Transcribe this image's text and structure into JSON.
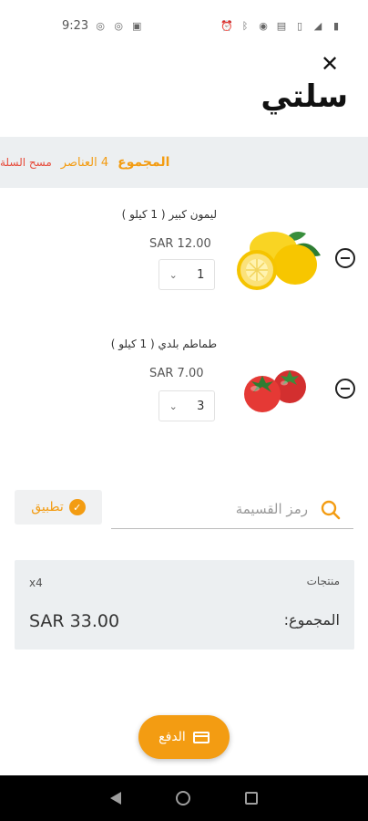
{
  "status_bar": {
    "time": "9:23",
    "icons": [
      "whatsapp-icon",
      "whatsapp-icon",
      "gallery-icon",
      "alarm-icon",
      "bluetooth-icon",
      "hotspot-icon",
      "nfc-icon",
      "vibrate-icon",
      "signal-icon",
      "battery-icon"
    ]
  },
  "header": {
    "title": "سلتي",
    "close_icon": "close-icon"
  },
  "summary": {
    "total_label": "المجموع",
    "items_count": "4 العناصر",
    "clear_label": "مسح السلة"
  },
  "items": [
    {
      "name": "ليمون كبير ( 1 كيلو )",
      "price": "SAR  12.00",
      "quantity": "1",
      "image": "lemon"
    },
    {
      "name": "طماطم بلدي ( 1 كيلو )",
      "price": "SAR  7.00",
      "quantity": "3",
      "image": "tomato"
    }
  ],
  "coupon": {
    "placeholder": "رمز القسيمة",
    "apply_label": "تطبيق"
  },
  "totals": {
    "products_label": "منتجات",
    "products_count": "x4",
    "total_label": "المجموع:",
    "total_value": "SAR  33.00"
  },
  "checkout": {
    "pay_label": "الدفع"
  },
  "colors": {
    "accent": "#f39c12",
    "danger": "#e74c3c",
    "panel": "#eceff1"
  }
}
